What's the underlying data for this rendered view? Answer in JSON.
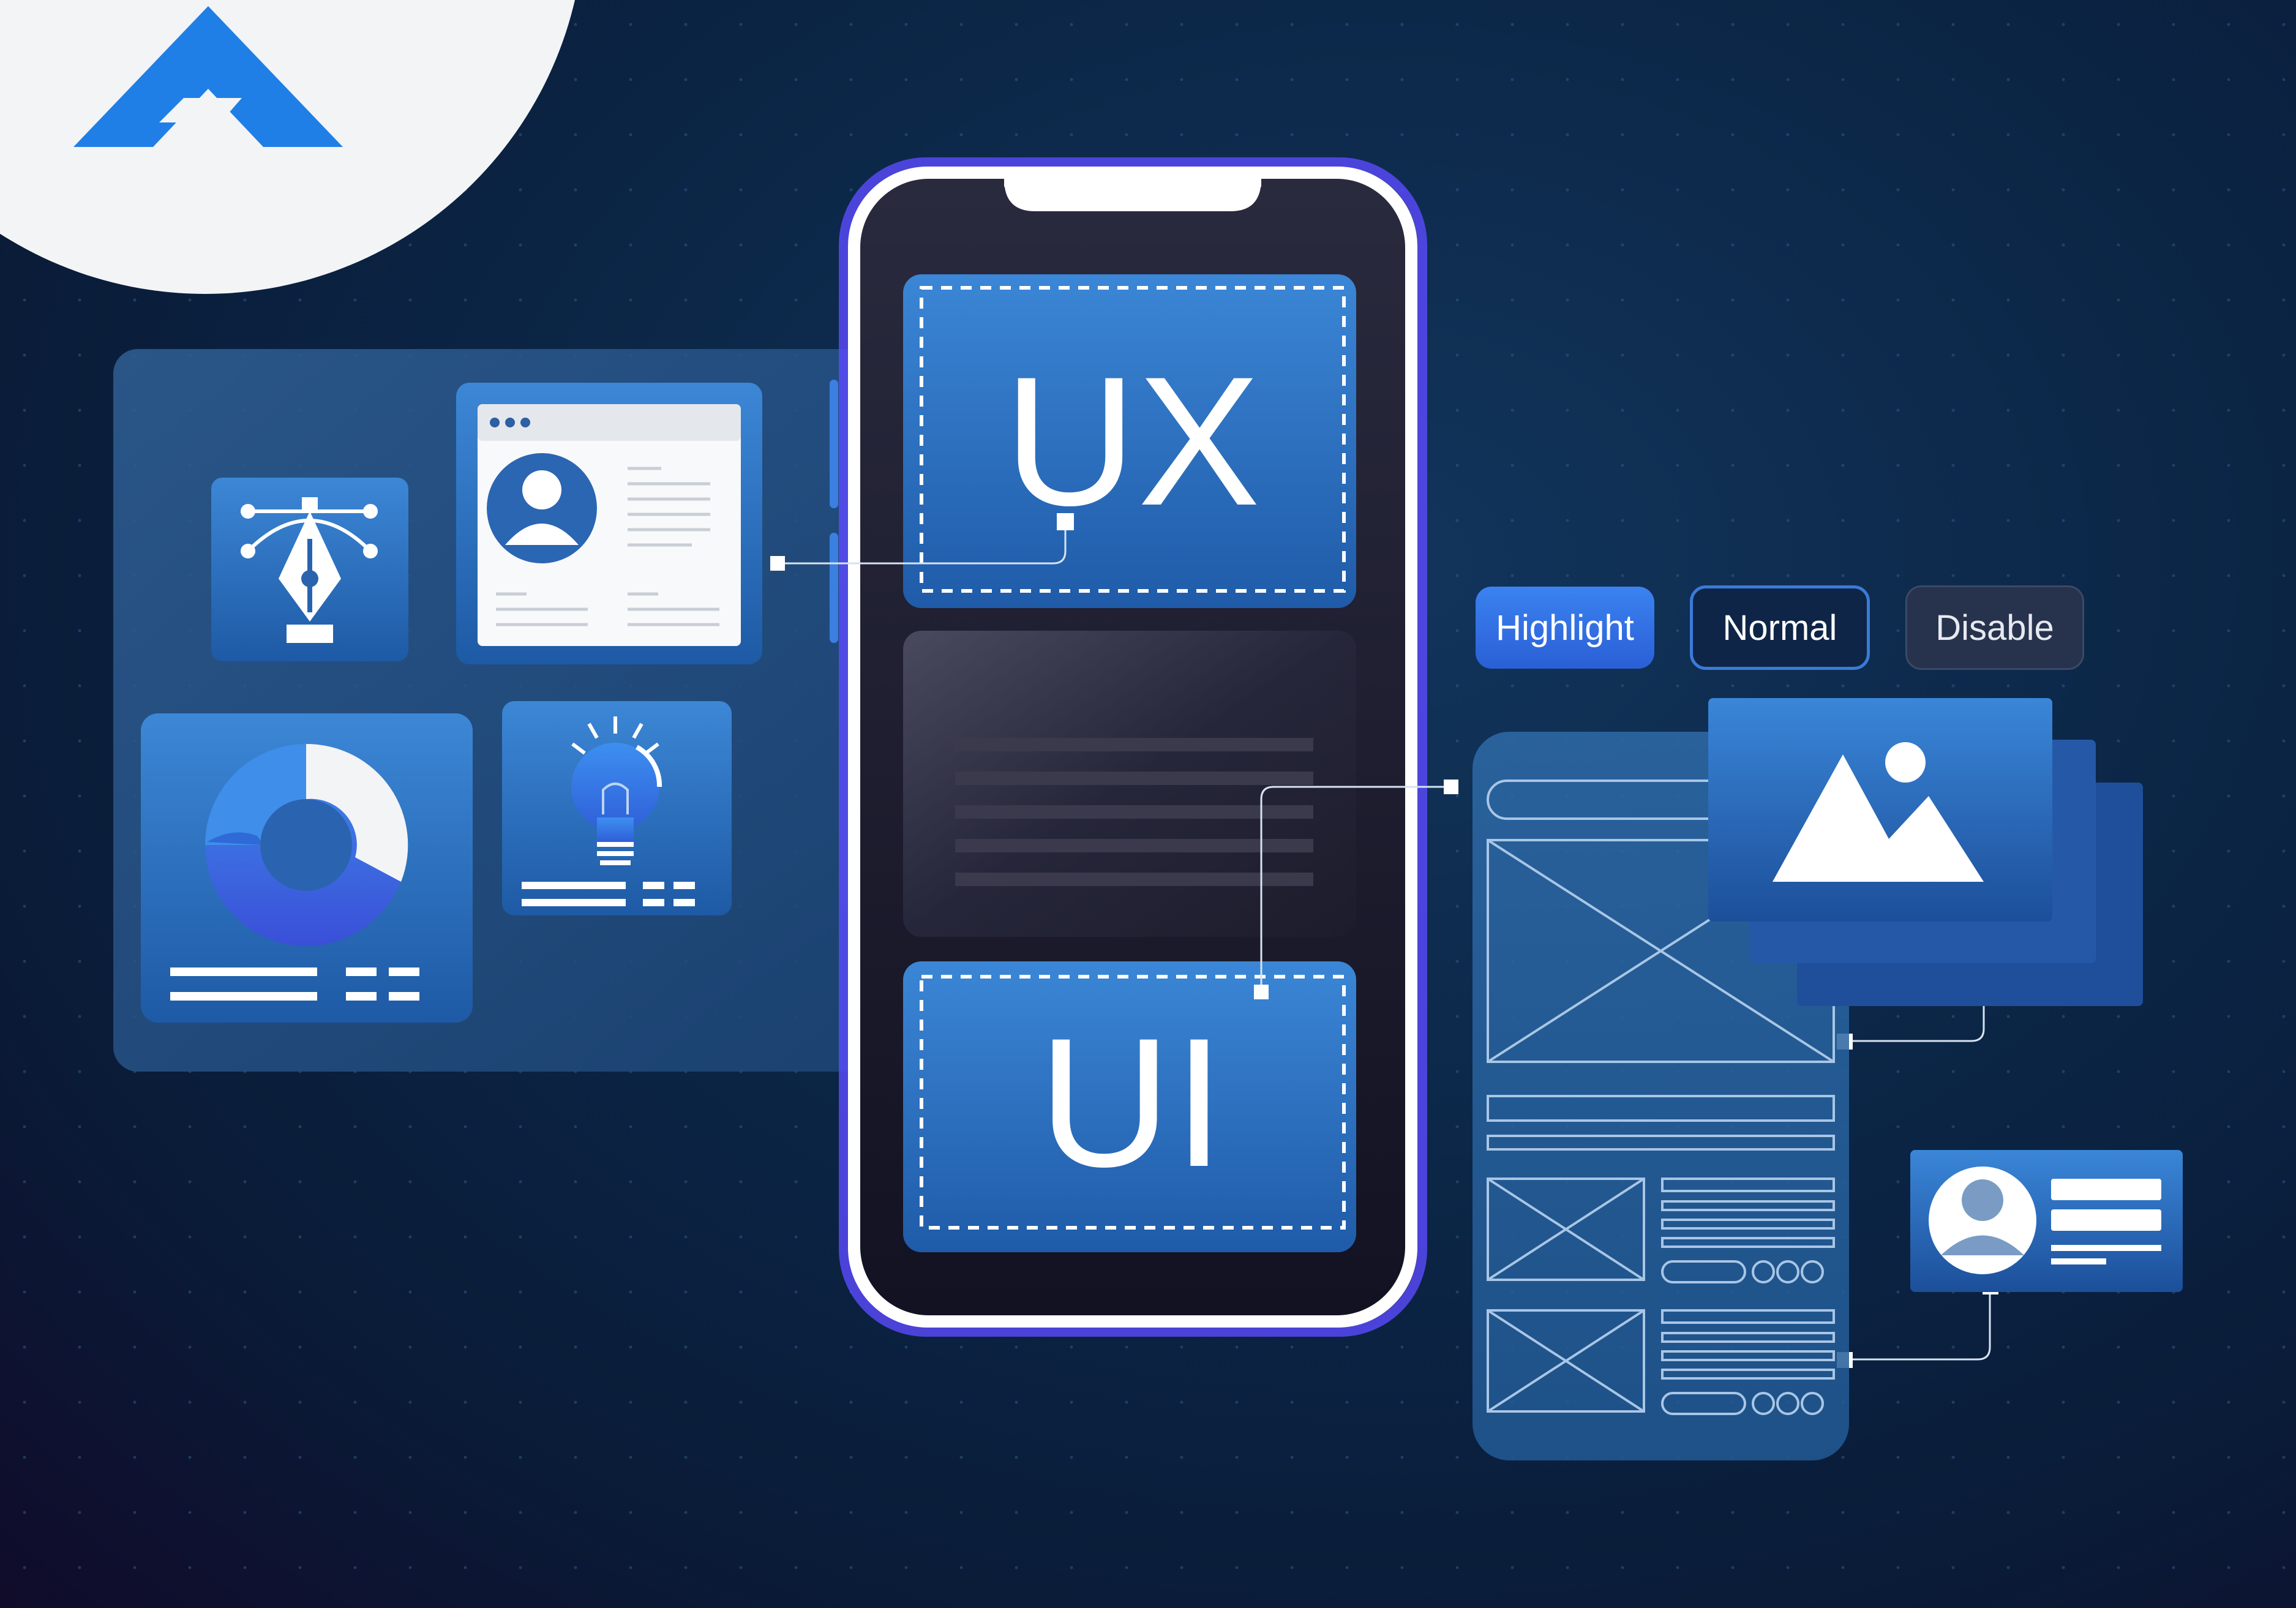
{
  "brand": {
    "logo_icon": "triangle-a-logo-icon",
    "logo_color": "#1f7fe6",
    "badge_color": "#f3f4f6"
  },
  "phone": {
    "top_block_label": "UX",
    "bottom_block_label": "UI"
  },
  "state_buttons": {
    "highlight_label": "Highlight",
    "normal_label": "Normal",
    "disable_label": "Disable"
  },
  "icons": [
    "pen-tool-icon",
    "profile-card-icon",
    "donut-chart-icon",
    "lightbulb-icon",
    "image-icon",
    "user-avatar-icon"
  ],
  "colors": {
    "accent_blue": "#2f74c8",
    "panel_blue": "#1f5aa0",
    "background_dark": "#0b2545",
    "phone_frame": "#ffffff",
    "phone_glow": "#5b4bff"
  }
}
